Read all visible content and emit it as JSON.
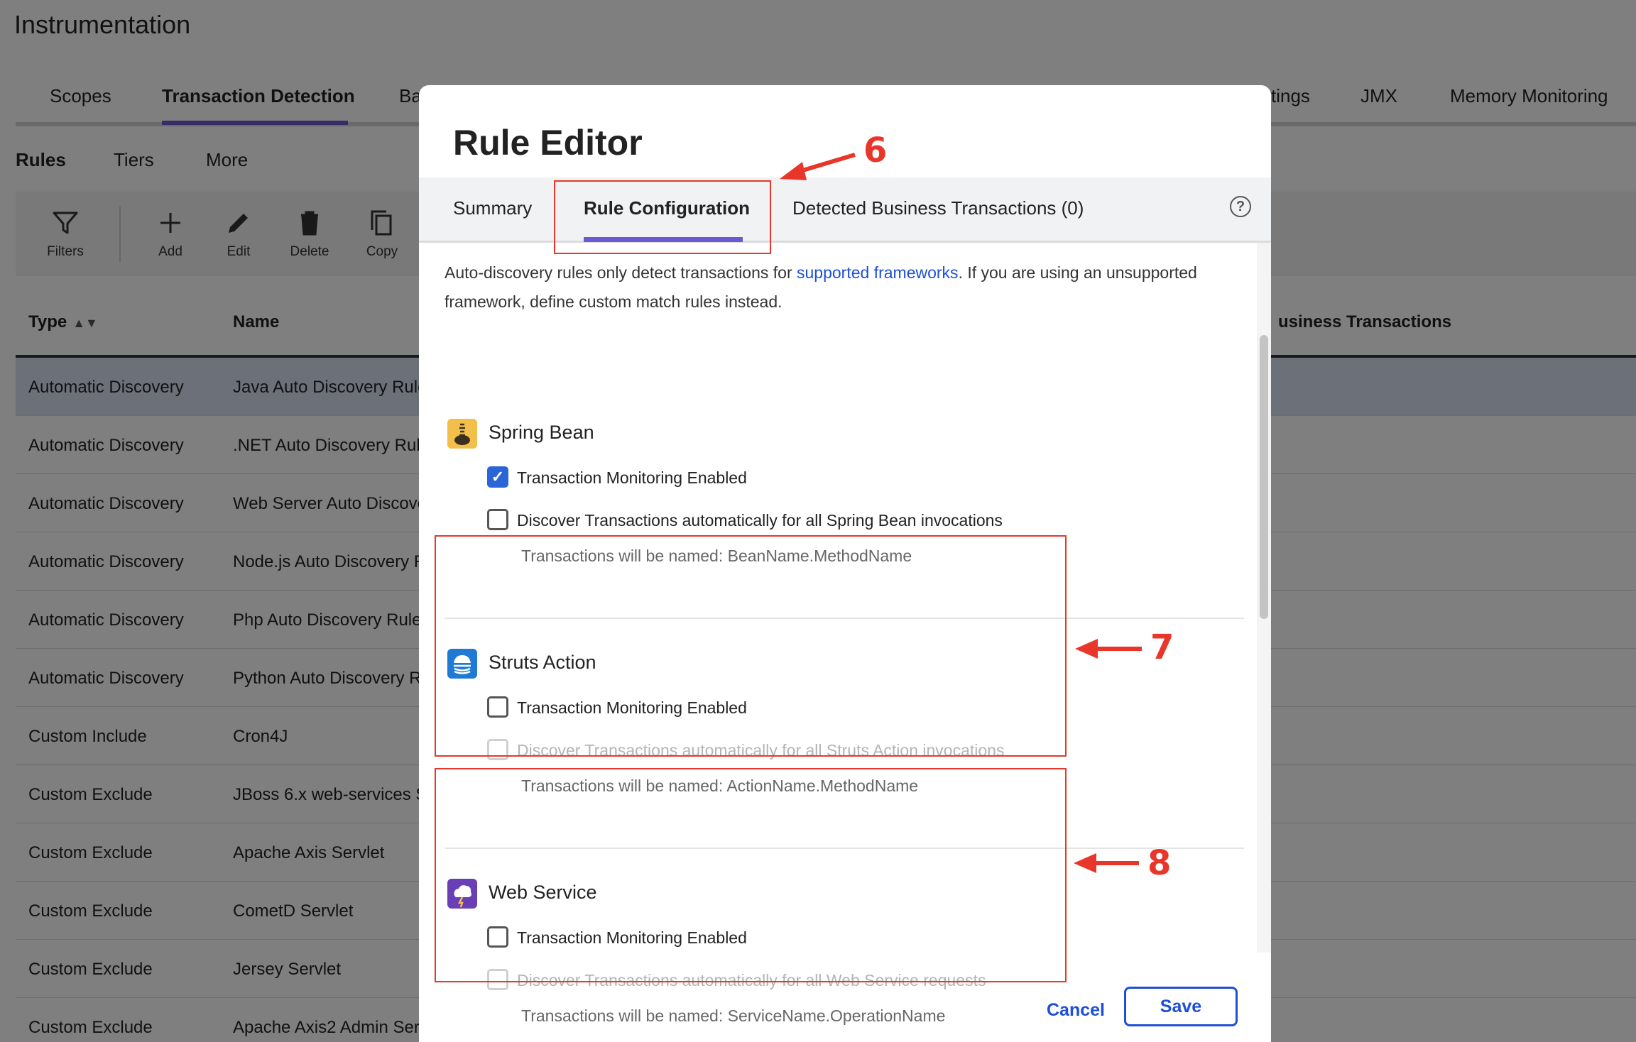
{
  "page": {
    "title": "Instrumentation",
    "tabs": [
      "Scopes",
      "Transaction Detection",
      "Ba",
      "tings",
      "JMX",
      "Memory Monitoring"
    ],
    "sub_tabs": [
      "Rules",
      "Tiers",
      "More"
    ]
  },
  "toolbar": {
    "filters": "Filters",
    "add": "Add",
    "edit": "Edit",
    "delete": "Delete",
    "copy": "Copy"
  },
  "table": {
    "headers": {
      "type": "Type",
      "name": "Name",
      "business": "usiness Transactions"
    },
    "rows": [
      {
        "type": "Automatic Discovery",
        "name": "Java Auto Discovery Rule"
      },
      {
        "type": "Automatic Discovery",
        "name": ".NET Auto Discovery Rule"
      },
      {
        "type": "Automatic Discovery",
        "name": "Web Server Auto Discove"
      },
      {
        "type": "Automatic Discovery",
        "name": "Node.js Auto Discovery R"
      },
      {
        "type": "Automatic Discovery",
        "name": "Php Auto Discovery Rule"
      },
      {
        "type": "Automatic Discovery",
        "name": "Python Auto Discovery R"
      },
      {
        "type": "Custom Include",
        "name": "Cron4J"
      },
      {
        "type": "Custom Exclude",
        "name": "JBoss 6.x web-services S"
      },
      {
        "type": "Custom Exclude",
        "name": "Apache Axis Servlet"
      },
      {
        "type": "Custom Exclude",
        "name": "CometD Servlet"
      },
      {
        "type": "Custom Exclude",
        "name": "Jersey Servlet"
      },
      {
        "type": "Custom Exclude",
        "name": "Apache Axis2 Admin Ser"
      }
    ]
  },
  "dialog": {
    "title": "Rule Editor",
    "tabs": {
      "summary": "Summary",
      "rule_configuration": "Rule Configuration",
      "detected": "Detected Business Transactions (0)"
    },
    "help": "?",
    "intro_before": "Auto-discovery rules only detect transactions for ",
    "intro_link": "supported frameworks",
    "intro_after": ". If you are using an unsupported framework, define custom match rules instead.",
    "sections": [
      {
        "title": "Spring Bean",
        "monitoring": "Transaction Monitoring Enabled",
        "monitoring_checked": true,
        "discover": "Discover Transactions automatically for all Spring Bean invocations",
        "discover_checked": false,
        "discover_disabled": false,
        "named": "Transactions will be named: BeanName.MethodName"
      },
      {
        "title": "Struts Action",
        "monitoring": "Transaction Monitoring Enabled",
        "monitoring_checked": false,
        "discover": "Discover Transactions automatically for all Struts Action invocations",
        "discover_checked": false,
        "discover_disabled": true,
        "named": "Transactions will be named: ActionName.MethodName"
      },
      {
        "title": "Web Service",
        "monitoring": "Transaction Monitoring Enabled",
        "monitoring_checked": false,
        "discover": "Discover Transactions automatically for all Web Service requests",
        "discover_checked": false,
        "discover_disabled": true,
        "named": "Transactions will be named: ServiceName.OperationName"
      }
    ],
    "cancel": "Cancel",
    "save": "Save"
  },
  "annotations": [
    "6",
    "7",
    "8"
  ],
  "colors": {
    "accent": "#6a5acd",
    "link": "#1d4fd8",
    "annotation": "#e8372a",
    "checkbox_checked": "#2965d6"
  }
}
